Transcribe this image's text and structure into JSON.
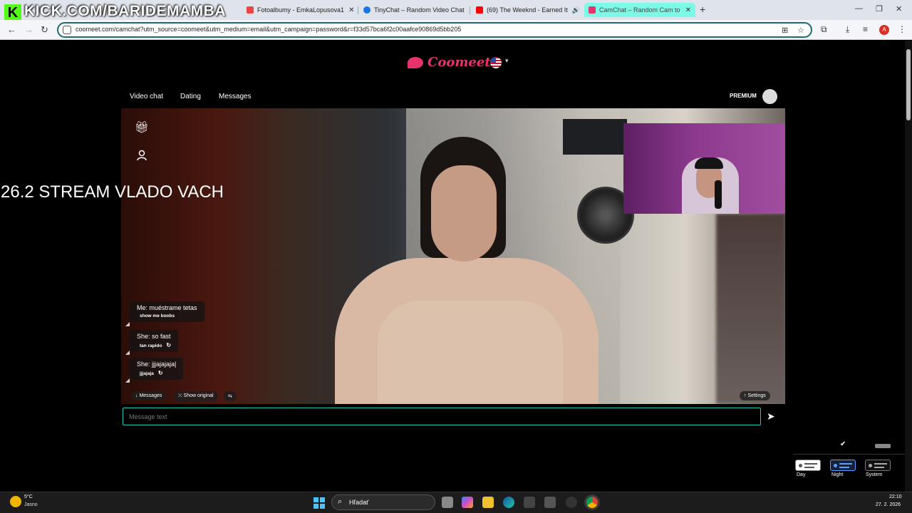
{
  "browser": {
    "tabs": [
      {
        "title": "Fotoalbumy - EmkaLopusova1"
      },
      {
        "title": "TinyChat – Random Video Chat"
      },
      {
        "title": "(69) The Weeknd - Earned It"
      },
      {
        "title": "CamChat – Random Cam to"
      }
    ],
    "url": "coomeet.com/camchat?utm_source=coomeet&utm_medium=email&utm_campaign=password&r=f33d57bca6f2c00aafce90869d5bb205",
    "profile_initial": "A",
    "new_tab": "+"
  },
  "overlay": {
    "kick_logo": "K",
    "kick_text": "KICK.COM/BARIDEMAMBA",
    "stream_text": "26.2 STREAM VLADO VACH"
  },
  "site": {
    "logo_text": "Coomeet",
    "nav": [
      "Video chat",
      "Dating",
      "Messages"
    ],
    "premium_label": "PREMIUM"
  },
  "chat": {
    "messages": [
      {
        "text": "Me: muéstrame tetas",
        "translation": "show me boobs"
      },
      {
        "text": "She: so fast",
        "translation": "tan rapido"
      },
      {
        "text": "She: jjjajajaja|",
        "translation": "jjjajaja"
      }
    ],
    "controls": {
      "messages": "Messages",
      "show_original": "Show original",
      "settings": "Settings"
    },
    "input_placeholder": "Message text"
  },
  "theme": {
    "options": [
      "Day",
      "Night",
      "System"
    ],
    "selected": "Night"
  },
  "taskbar": {
    "temperature": "5°C",
    "condition": "Jasno",
    "search_label": "Hľadať",
    "time": "22:10",
    "date": "27. 2. 2026"
  },
  "colors": {
    "brand": "#e6336c",
    "accent_border": "#1fc7b6",
    "kick_green": "#53fc18",
    "active_tab": "#7df9e7"
  }
}
